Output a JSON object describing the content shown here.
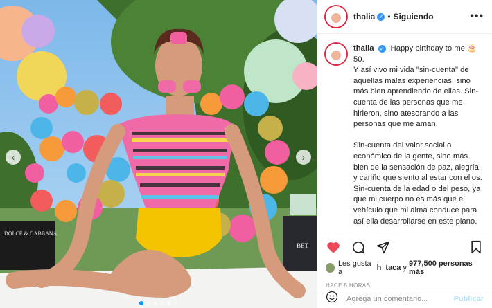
{
  "header": {
    "username": "thalia",
    "separator": "•",
    "follow_status": "Siguiendo",
    "more_label": "•••"
  },
  "caption": {
    "username": "thalia",
    "text": "¡Happy birthday to me!🎂 50.\nY así vivo mi vida \"sin-cuenta\" de aquellas malas experiencias, sino más bien aprendiendo de ellas. Sin-cuenta de las personas que me hirieron, sino atesorando a las personas que me aman.\n\nSin-cuenta del valor social o económico de la gente, sino más bien de la sensación de paz, alegría y cariño que siento al estar con ellos. Sin-cuenta de la edad o del peso, ya que mi cuerpo no es más que el vehículo que mi alma conduce para así ella desarrollarse en este plano.\n\nSin-cuenta de resentimientos envidias o corajes, ya que al sentirlos o al recibirlos y apoderarte se..."
  },
  "actions": {
    "likes_prefix": "Les gusta a",
    "likes_user": "h_taca",
    "likes_middle": "y",
    "likes_count": "977,500 personas más",
    "time_ago": "HACE 5 HORAS"
  },
  "comment": {
    "placeholder": "Agrega un comentario...",
    "publish_label": "Publicar"
  },
  "photo": {
    "brand_left": "DOLCE & GABBANA",
    "brand_right": "BET",
    "carousel_count": 6,
    "carousel_active": 1
  },
  "colors": {
    "verified": "#3897f0",
    "heart": "#ed4956",
    "publish_disabled": "#b2dffc",
    "sky": "#8cc4f0",
    "yellow_shorts": "#f5c400"
  },
  "icons": [
    "heart-icon",
    "comment-icon",
    "share-icon",
    "bookmark-icon",
    "emoji-icon",
    "verified-icon",
    "more-icon"
  ]
}
